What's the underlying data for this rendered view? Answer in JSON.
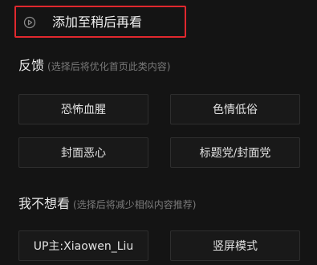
{
  "watch_later": {
    "icon": "clock-play-icon",
    "label": "添加至稍后再看"
  },
  "feedback": {
    "title": "反馈",
    "hint": "(选择后将优化首页此类内容)",
    "options": [
      "恐怖血腥",
      "色情低俗",
      "封面恶心",
      "标题党/封面党"
    ]
  },
  "not_interested": {
    "title": "我不想看",
    "hint": "(选择后将减少相似内容推荐)",
    "options": [
      "UP主:Xiaowen_Liu",
      "竖屏模式"
    ]
  },
  "colors": {
    "highlight_border": "#e0282e",
    "background": "#141414"
  }
}
